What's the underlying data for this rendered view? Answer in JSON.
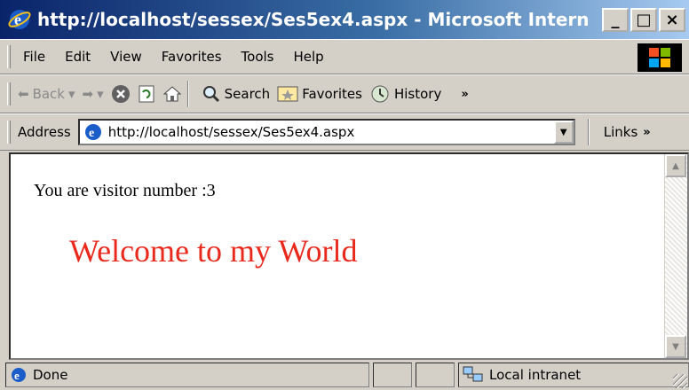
{
  "window": {
    "title": "http://localhost/sessex/Ses5ex4.aspx - Microsoft Interne...",
    "min": "_",
    "max": "□",
    "close": "×"
  },
  "menu": {
    "items": [
      "File",
      "Edit",
      "View",
      "Favorites",
      "Tools",
      "Help"
    ]
  },
  "toolbar": {
    "back": "Back",
    "search": "Search",
    "favorites": "Favorites",
    "history": "History",
    "more": "»"
  },
  "address": {
    "label": "Address",
    "url": "http://localhost/sessex/Ses5ex4.aspx",
    "links": "Links",
    "more": "»"
  },
  "content": {
    "visitor": "You are visitor number :3",
    "welcome": "Welcome to my World"
  },
  "status": {
    "text": "Done",
    "zone": "Local intranet"
  },
  "colors": {
    "title_start": "#0a246a",
    "title_end": "#a6caf0",
    "welcome": "#e8291c"
  }
}
